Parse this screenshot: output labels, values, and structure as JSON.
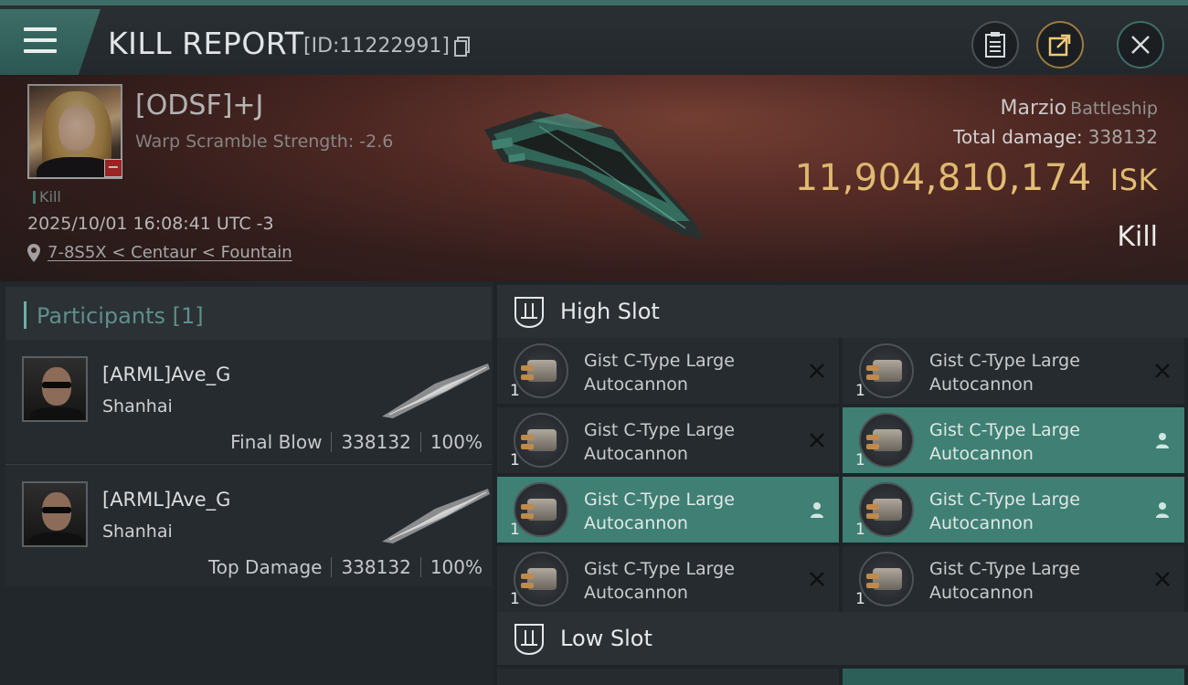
{
  "header": {
    "title": "KILL REPORT",
    "report_id": "[ID:11222991]"
  },
  "victim": {
    "name": "[ODSF]+J",
    "warp_scramble": "Warp Scramble Strength: -2.6",
    "kill_tag": "Kill",
    "datetime": "2025/10/01 16:08:41 UTC -3",
    "location": "7-8S5X < Centaur < Fountain"
  },
  "ship": {
    "name": "Marzio",
    "class": "Battleship",
    "total_damage_label": "Total damage:",
    "total_damage_value": "338132",
    "isk_value": "11,904,810,174",
    "isk_unit": "ISK",
    "result": "Kill"
  },
  "participants": {
    "label": "Participants",
    "count": "[1]",
    "rows": [
      {
        "name": "[ARML]Ave_G",
        "corp": "Shanhai",
        "role": "Final Blow",
        "damage": "338132",
        "percent": "100%"
      },
      {
        "name": "[ARML]Ave_G",
        "corp": "Shanhai",
        "role": "Top Damage",
        "damage": "338132",
        "percent": "100%"
      }
    ]
  },
  "slots": {
    "high_label": "High Slot",
    "low_label": "Low Slot",
    "modules": [
      {
        "line1": "Gist C-Type Large",
        "line2": "Autocannon",
        "qty": "1",
        "status": "destroyed"
      },
      {
        "line1": "Gist C-Type Large",
        "line2": "Autocannon",
        "qty": "1",
        "status": "destroyed"
      },
      {
        "line1": "Gist C-Type Large",
        "line2": "Autocannon",
        "qty": "1",
        "status": "destroyed"
      },
      {
        "line1": "Gist C-Type Large",
        "line2": "Autocannon",
        "qty": "1",
        "status": "dropped"
      },
      {
        "line1": "Gist C-Type Large",
        "line2": "Autocannon",
        "qty": "1",
        "status": "dropped"
      },
      {
        "line1": "Gist C-Type Large",
        "line2": "Autocannon",
        "qty": "1",
        "status": "dropped"
      },
      {
        "line1": "Gist C-Type Large",
        "line2": "Autocannon",
        "qty": "1",
        "status": "destroyed"
      },
      {
        "line1": "Gist C-Type Large",
        "line2": "Autocannon",
        "qty": "1",
        "status": "destroyed"
      }
    ]
  },
  "colors": {
    "accent_teal": "#3f7f74",
    "isk_gold": "#f1c979",
    "danger_red": "#c42a2a"
  }
}
